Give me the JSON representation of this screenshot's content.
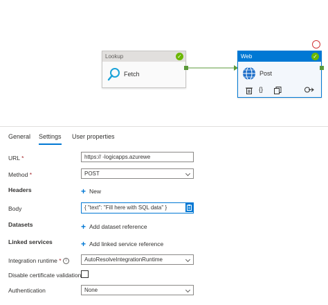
{
  "canvas": {
    "lookup": {
      "type_label": "Lookup",
      "name": "Fetch"
    },
    "web": {
      "type_label": "Web",
      "name": "Post"
    }
  },
  "tabs": [
    {
      "label": "General"
    },
    {
      "label": "Settings",
      "active": true
    },
    {
      "label": "User properties"
    }
  ],
  "form": {
    "url": {
      "label": "URL",
      "value": "https://                        -logicapps.azurewe"
    },
    "method": {
      "label": "Method",
      "value": "POST"
    },
    "headers": {
      "label": "Headers",
      "new_label": "New"
    },
    "body": {
      "label": "Body",
      "value": "{ \"text\": \"Fill here with SQL data\" }"
    },
    "datasets": {
      "label": "Datasets",
      "add_label": "Add dataset reference"
    },
    "linked_services": {
      "label": "Linked services",
      "add_label": "Add linked service reference"
    },
    "integration_runtime": {
      "label": "Integration runtime",
      "value": "AutoResolveIntegrationRuntime"
    },
    "disable_cert": {
      "label": "Disable certificate validation"
    },
    "authentication": {
      "label": "Authentication",
      "value": "None"
    }
  },
  "colors": {
    "accent": "#0078d4",
    "success": "#6bb700",
    "web_header": "#0078d4",
    "required": "#a4262c"
  }
}
